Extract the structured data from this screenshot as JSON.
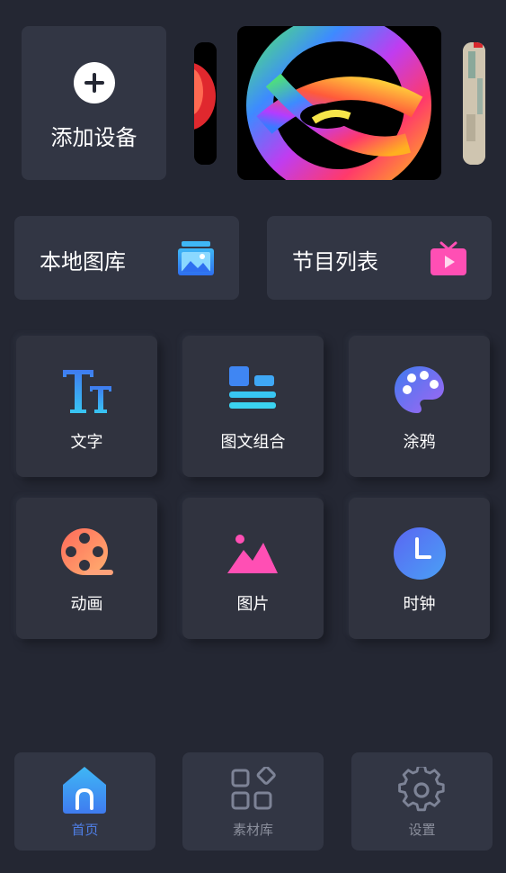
{
  "carousel": {
    "add_device_label": "添加设备"
  },
  "quick_entries": [
    {
      "label": "本地图库",
      "icon": "gallery-icon",
      "color": "#3fb7f5"
    },
    {
      "label": "节目列表",
      "icon": "tv-icon",
      "color": "#ff4fb4"
    }
  ],
  "tools": [
    {
      "label": "文字",
      "icon": "text-icon"
    },
    {
      "label": "图文组合",
      "icon": "layout-icon"
    },
    {
      "label": "涂鸦",
      "icon": "palette-icon"
    },
    {
      "label": "动画",
      "icon": "film-reel-icon"
    },
    {
      "label": "图片",
      "icon": "image-icon"
    },
    {
      "label": "时钟",
      "icon": "clock-icon"
    }
  ],
  "bottom_nav": [
    {
      "label": "首页",
      "icon": "home-icon",
      "active": true
    },
    {
      "label": "素材库",
      "icon": "material-icon",
      "active": false
    },
    {
      "label": "设置",
      "icon": "gear-icon",
      "active": false
    }
  ],
  "colors": {
    "background": "#242733",
    "card": "#323644",
    "accent_blue": "#4f7fe6",
    "accent_pink": "#ff4fb4",
    "inactive": "#8b8f9c"
  }
}
